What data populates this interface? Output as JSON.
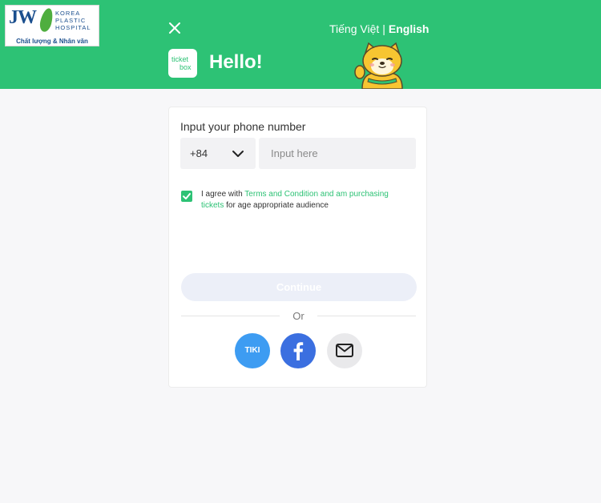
{
  "clinic_logo": {
    "mark": "JW",
    "name": "KOREA\nPLASTIC\nHOSPITAL",
    "tagline": "Chất lượng & Nhân văn"
  },
  "header": {
    "close_icon": "close-icon",
    "languages": {
      "vietnamese": "Tiếng Việt",
      "separator": "|",
      "english": "English",
      "active": "English"
    },
    "logo": {
      "line1": "ticket",
      "line2": "box"
    },
    "greeting": "Hello!",
    "mascot_icon": "shiba-mascot"
  },
  "form": {
    "phone_label": "Input your phone number",
    "country_code": "+84",
    "country_code_icon": "chevron-down-icon",
    "phone_placeholder": "Input here",
    "phone_value": "",
    "agree_checked": true,
    "agree_prefix": "I agree with ",
    "agree_link": "Terms and Condition and am purchasing tickets",
    "agree_suffix": " for age appropriate audience",
    "continue_label": "Continue",
    "or_label": "Or",
    "social": {
      "tiki_label": "TIKI",
      "facebook_icon": "facebook-icon",
      "email_icon": "mail-icon"
    }
  },
  "colors": {
    "brand_green": "#2dc275",
    "page_background": "#f7f7f9",
    "continue_disabled": "#eceff8",
    "tiki_blue": "#3d9cf2",
    "facebook_blue": "#3b6fe0"
  }
}
